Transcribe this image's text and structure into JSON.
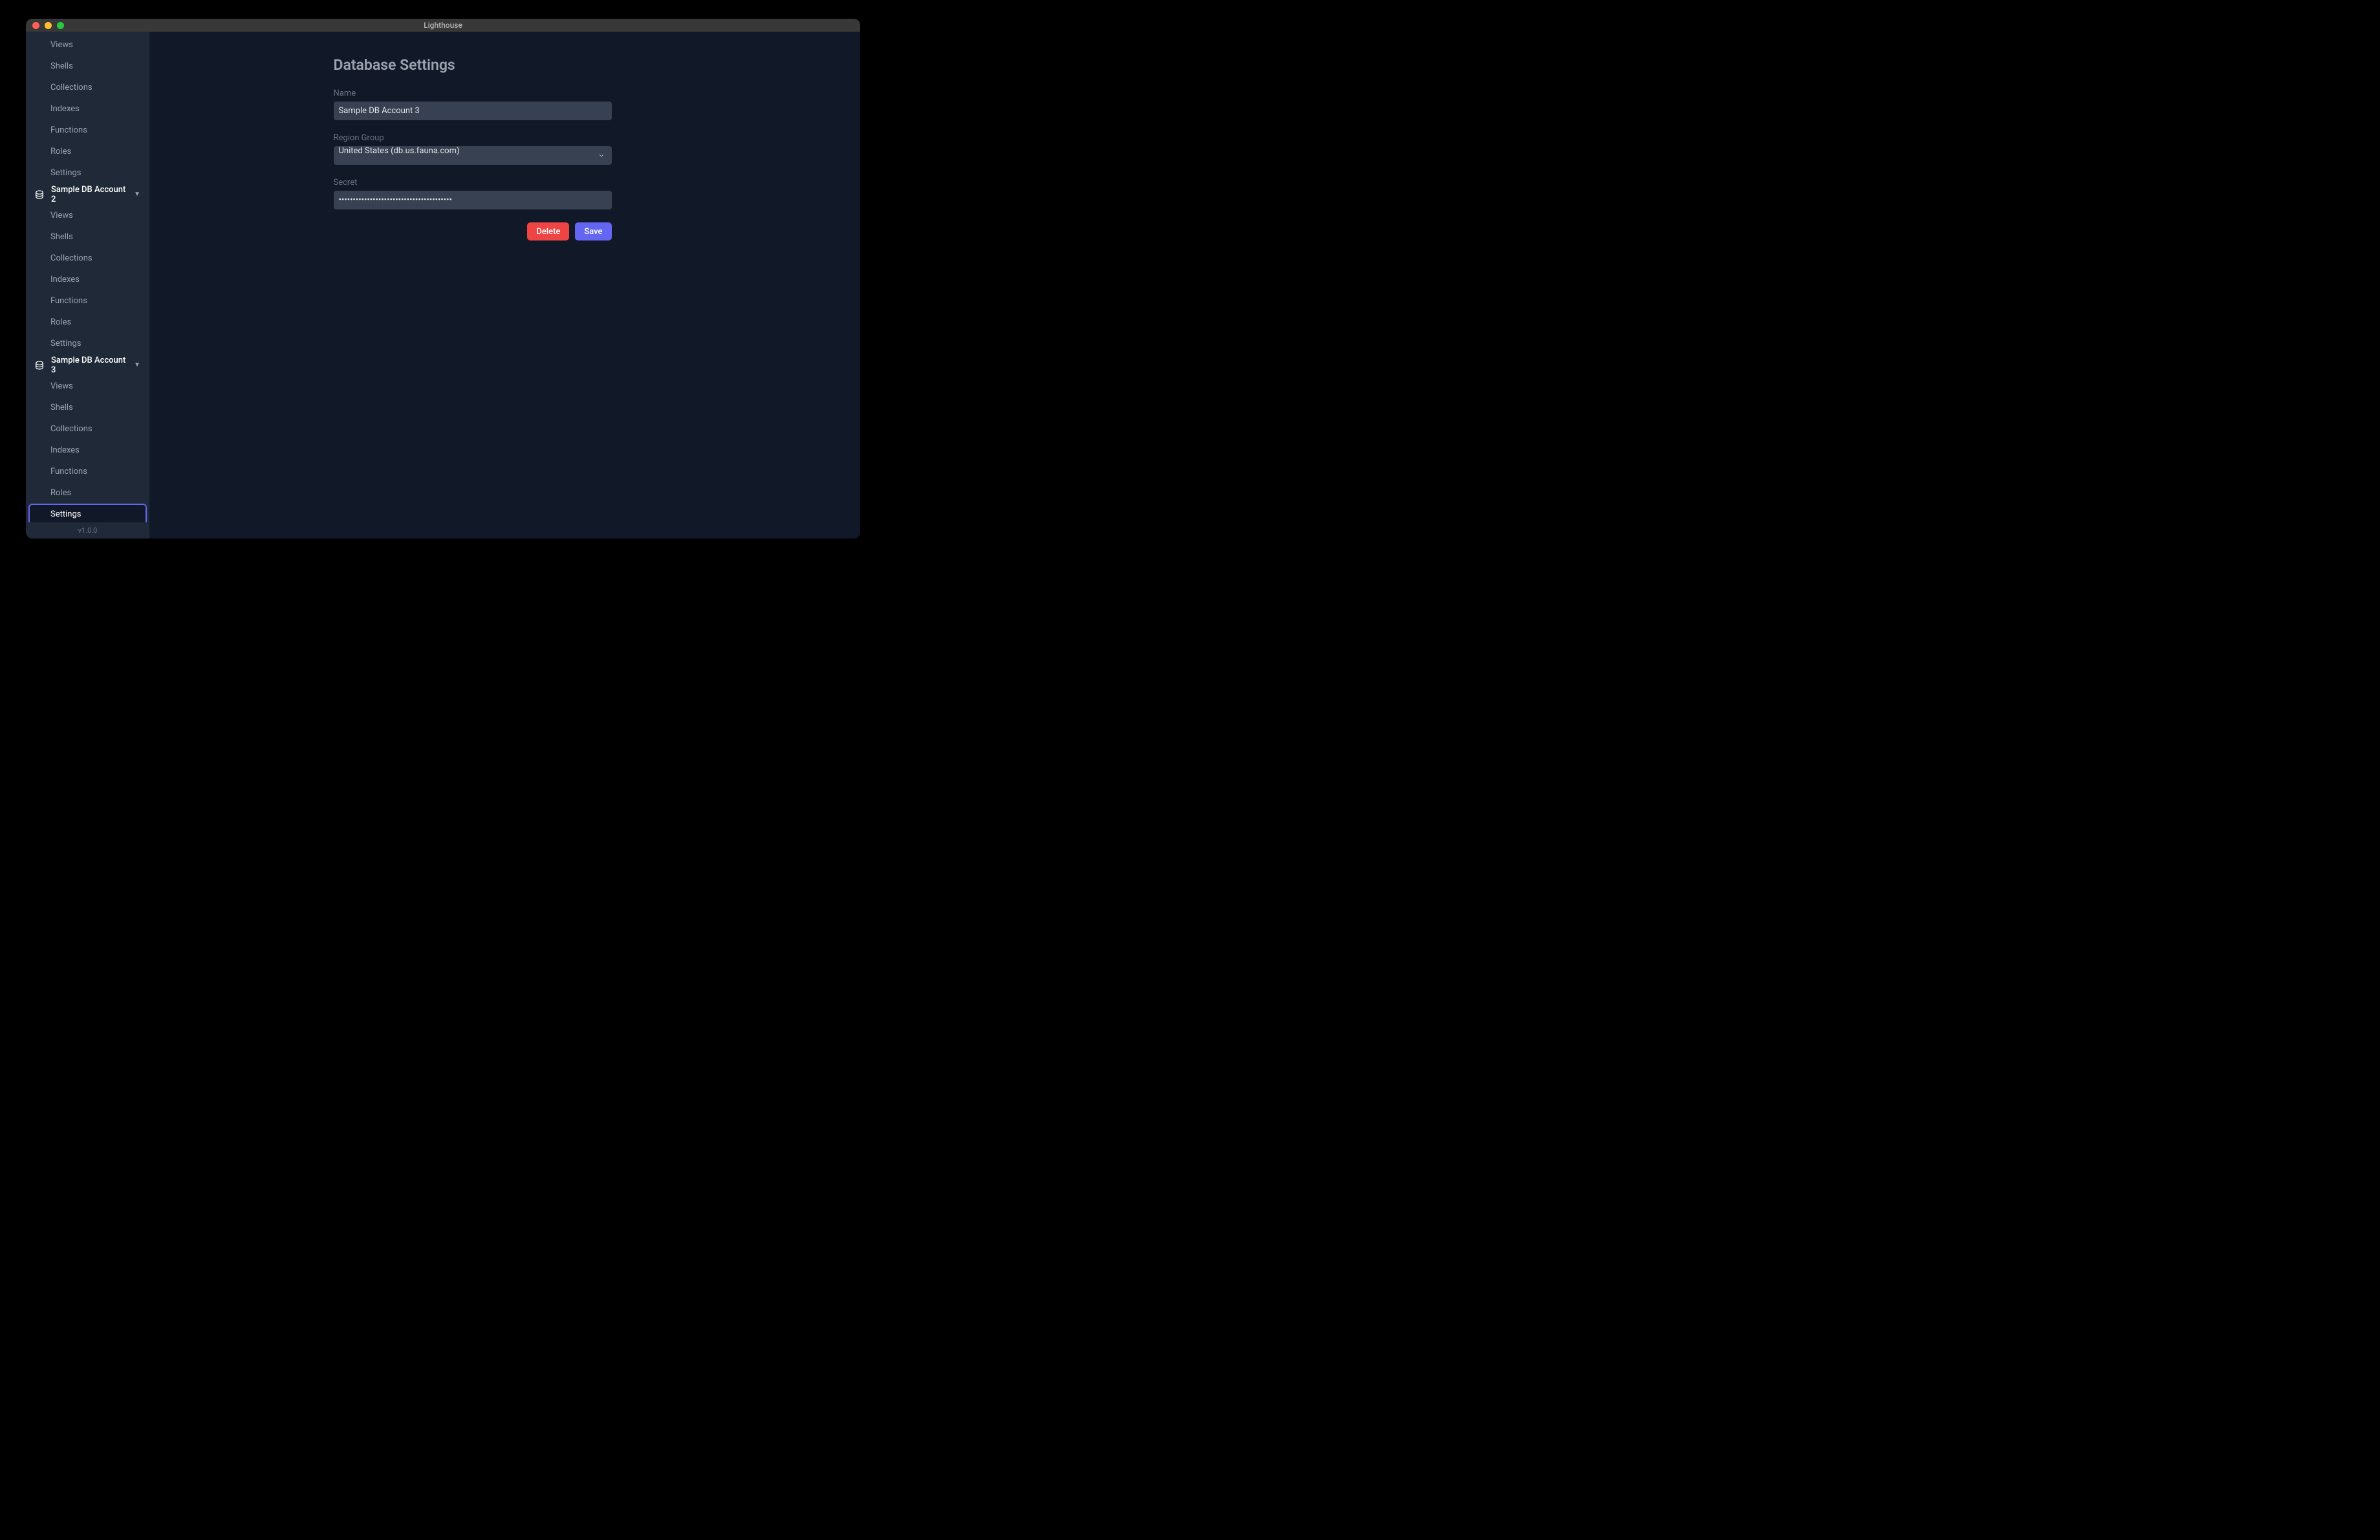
{
  "window": {
    "title": "Lighthouse"
  },
  "sidebar": {
    "accounts": [
      {
        "name": "",
        "items": [
          {
            "label": "Views"
          },
          {
            "label": "Shells"
          },
          {
            "label": "Collections"
          },
          {
            "label": "Indexes"
          },
          {
            "label": "Functions"
          },
          {
            "label": "Roles"
          },
          {
            "label": "Settings"
          }
        ]
      },
      {
        "name": "Sample DB Account 2",
        "items": [
          {
            "label": "Views"
          },
          {
            "label": "Shells"
          },
          {
            "label": "Collections"
          },
          {
            "label": "Indexes"
          },
          {
            "label": "Functions"
          },
          {
            "label": "Roles"
          },
          {
            "label": "Settings"
          }
        ]
      },
      {
        "name": "Sample DB Account 3",
        "items": [
          {
            "label": "Views"
          },
          {
            "label": "Shells"
          },
          {
            "label": "Collections"
          },
          {
            "label": "Indexes"
          },
          {
            "label": "Functions"
          },
          {
            "label": "Roles"
          },
          {
            "label": "Settings"
          }
        ]
      }
    ],
    "version": "v1.0.0"
  },
  "main": {
    "title": "Database Settings",
    "form": {
      "name_label": "Name",
      "name_value": "Sample DB Account 3",
      "region_label": "Region Group",
      "region_value": "United States (db.us.fauna.com)",
      "secret_label": "Secret",
      "secret_value": "••••••••••••••••••••••••••••••••••••••••"
    },
    "buttons": {
      "delete": "Delete",
      "save": "Save"
    }
  }
}
